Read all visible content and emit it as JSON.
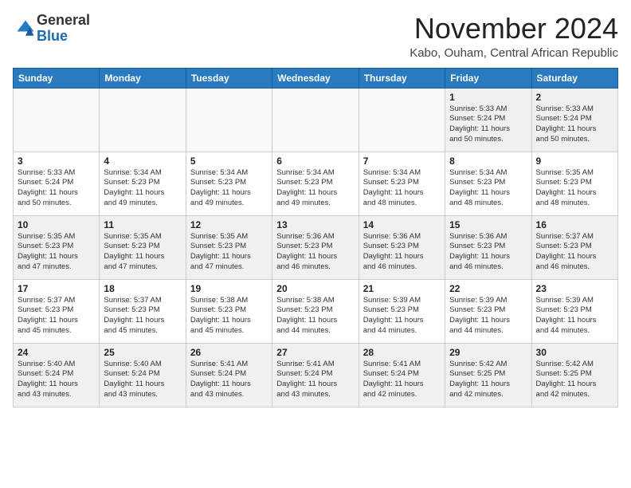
{
  "header": {
    "logo_line1": "General",
    "logo_line2": "Blue",
    "month_title": "November 2024",
    "location": "Kabo, Ouham, Central African Republic"
  },
  "weekdays": [
    "Sunday",
    "Monday",
    "Tuesday",
    "Wednesday",
    "Thursday",
    "Friday",
    "Saturday"
  ],
  "weeks": [
    [
      {
        "day": "",
        "info": "",
        "empty": true
      },
      {
        "day": "",
        "info": "",
        "empty": true
      },
      {
        "day": "",
        "info": "",
        "empty": true
      },
      {
        "day": "",
        "info": "",
        "empty": true
      },
      {
        "day": "",
        "info": "",
        "empty": true
      },
      {
        "day": "1",
        "info": "Sunrise: 5:33 AM\nSunset: 5:24 PM\nDaylight: 11 hours\nand 50 minutes.",
        "empty": false
      },
      {
        "day": "2",
        "info": "Sunrise: 5:33 AM\nSunset: 5:24 PM\nDaylight: 11 hours\nand 50 minutes.",
        "empty": false
      }
    ],
    [
      {
        "day": "3",
        "info": "Sunrise: 5:33 AM\nSunset: 5:24 PM\nDaylight: 11 hours\nand 50 minutes.",
        "empty": false
      },
      {
        "day": "4",
        "info": "Sunrise: 5:34 AM\nSunset: 5:23 PM\nDaylight: 11 hours\nand 49 minutes.",
        "empty": false
      },
      {
        "day": "5",
        "info": "Sunrise: 5:34 AM\nSunset: 5:23 PM\nDaylight: 11 hours\nand 49 minutes.",
        "empty": false
      },
      {
        "day": "6",
        "info": "Sunrise: 5:34 AM\nSunset: 5:23 PM\nDaylight: 11 hours\nand 49 minutes.",
        "empty": false
      },
      {
        "day": "7",
        "info": "Sunrise: 5:34 AM\nSunset: 5:23 PM\nDaylight: 11 hours\nand 48 minutes.",
        "empty": false
      },
      {
        "day": "8",
        "info": "Sunrise: 5:34 AM\nSunset: 5:23 PM\nDaylight: 11 hours\nand 48 minutes.",
        "empty": false
      },
      {
        "day": "9",
        "info": "Sunrise: 5:35 AM\nSunset: 5:23 PM\nDaylight: 11 hours\nand 48 minutes.",
        "empty": false
      }
    ],
    [
      {
        "day": "10",
        "info": "Sunrise: 5:35 AM\nSunset: 5:23 PM\nDaylight: 11 hours\nand 47 minutes.",
        "empty": false
      },
      {
        "day": "11",
        "info": "Sunrise: 5:35 AM\nSunset: 5:23 PM\nDaylight: 11 hours\nand 47 minutes.",
        "empty": false
      },
      {
        "day": "12",
        "info": "Sunrise: 5:35 AM\nSunset: 5:23 PM\nDaylight: 11 hours\nand 47 minutes.",
        "empty": false
      },
      {
        "day": "13",
        "info": "Sunrise: 5:36 AM\nSunset: 5:23 PM\nDaylight: 11 hours\nand 46 minutes.",
        "empty": false
      },
      {
        "day": "14",
        "info": "Sunrise: 5:36 AM\nSunset: 5:23 PM\nDaylight: 11 hours\nand 46 minutes.",
        "empty": false
      },
      {
        "day": "15",
        "info": "Sunrise: 5:36 AM\nSunset: 5:23 PM\nDaylight: 11 hours\nand 46 minutes.",
        "empty": false
      },
      {
        "day": "16",
        "info": "Sunrise: 5:37 AM\nSunset: 5:23 PM\nDaylight: 11 hours\nand 46 minutes.",
        "empty": false
      }
    ],
    [
      {
        "day": "17",
        "info": "Sunrise: 5:37 AM\nSunset: 5:23 PM\nDaylight: 11 hours\nand 45 minutes.",
        "empty": false
      },
      {
        "day": "18",
        "info": "Sunrise: 5:37 AM\nSunset: 5:23 PM\nDaylight: 11 hours\nand 45 minutes.",
        "empty": false
      },
      {
        "day": "19",
        "info": "Sunrise: 5:38 AM\nSunset: 5:23 PM\nDaylight: 11 hours\nand 45 minutes.",
        "empty": false
      },
      {
        "day": "20",
        "info": "Sunrise: 5:38 AM\nSunset: 5:23 PM\nDaylight: 11 hours\nand 44 minutes.",
        "empty": false
      },
      {
        "day": "21",
        "info": "Sunrise: 5:39 AM\nSunset: 5:23 PM\nDaylight: 11 hours\nand 44 minutes.",
        "empty": false
      },
      {
        "day": "22",
        "info": "Sunrise: 5:39 AM\nSunset: 5:23 PM\nDaylight: 11 hours\nand 44 minutes.",
        "empty": false
      },
      {
        "day": "23",
        "info": "Sunrise: 5:39 AM\nSunset: 5:23 PM\nDaylight: 11 hours\nand 44 minutes.",
        "empty": false
      }
    ],
    [
      {
        "day": "24",
        "info": "Sunrise: 5:40 AM\nSunset: 5:24 PM\nDaylight: 11 hours\nand 43 minutes.",
        "empty": false
      },
      {
        "day": "25",
        "info": "Sunrise: 5:40 AM\nSunset: 5:24 PM\nDaylight: 11 hours\nand 43 minutes.",
        "empty": false
      },
      {
        "day": "26",
        "info": "Sunrise: 5:41 AM\nSunset: 5:24 PM\nDaylight: 11 hours\nand 43 minutes.",
        "empty": false
      },
      {
        "day": "27",
        "info": "Sunrise: 5:41 AM\nSunset: 5:24 PM\nDaylight: 11 hours\nand 43 minutes.",
        "empty": false
      },
      {
        "day": "28",
        "info": "Sunrise: 5:41 AM\nSunset: 5:24 PM\nDaylight: 11 hours\nand 42 minutes.",
        "empty": false
      },
      {
        "day": "29",
        "info": "Sunrise: 5:42 AM\nSunset: 5:25 PM\nDaylight: 11 hours\nand 42 minutes.",
        "empty": false
      },
      {
        "day": "30",
        "info": "Sunrise: 5:42 AM\nSunset: 5:25 PM\nDaylight: 11 hours\nand 42 minutes.",
        "empty": false
      }
    ]
  ]
}
